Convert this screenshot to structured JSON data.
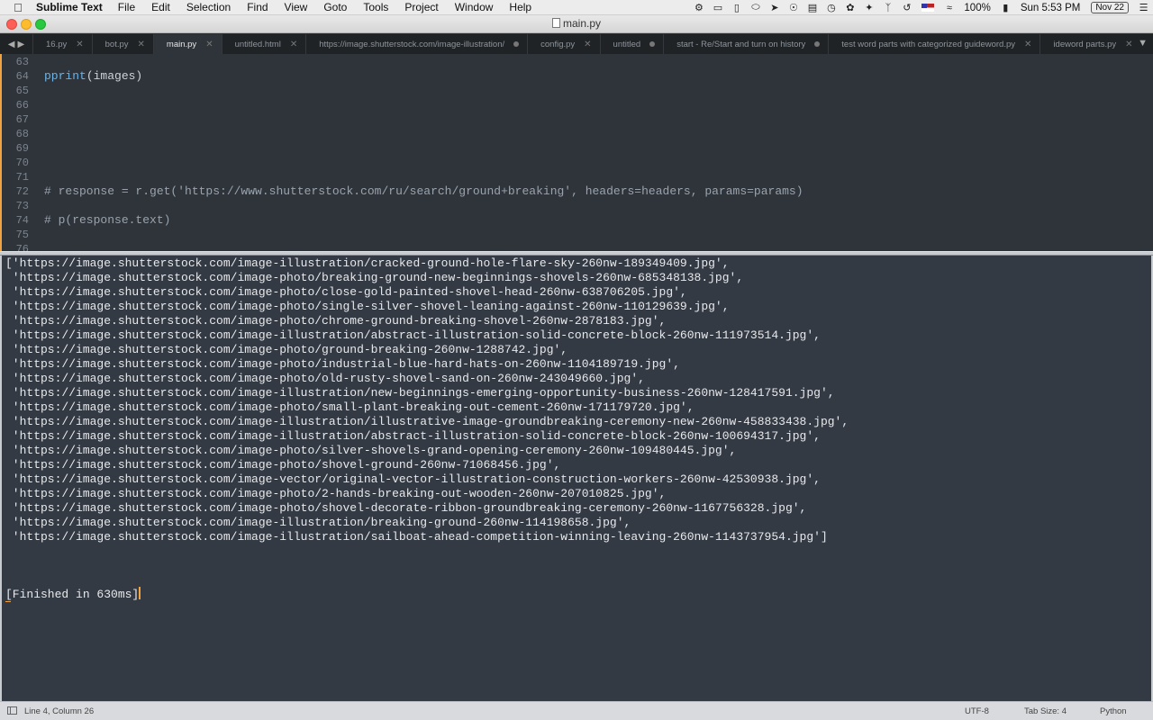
{
  "menubar": {
    "app_name": "Sublime Text",
    "items": [
      "File",
      "Edit",
      "Selection",
      "Find",
      "View",
      "Goto",
      "Tools",
      "Project",
      "Window",
      "Help"
    ],
    "battery": "100%",
    "clock": "Sun 5:53 PM",
    "date_badge": "Nov 22"
  },
  "window": {
    "title": "main.py"
  },
  "tabs": [
    {
      "label": "16.py",
      "state": "close"
    },
    {
      "label": "bot.py",
      "state": "close"
    },
    {
      "label": "main.py",
      "state": "close",
      "active": true
    },
    {
      "label": "untitled.html",
      "state": "close"
    },
    {
      "label": "https://image.shutterstock.com/image-illustration/",
      "state": "dirty"
    },
    {
      "label": "config.py",
      "state": "close"
    },
    {
      "label": "untitled",
      "state": "dirty"
    },
    {
      "label": "start - Re/Start and turn on history",
      "state": "dirty"
    },
    {
      "label": "test word parts with categorized guideword.py",
      "state": "close"
    },
    {
      "label": "ideword parts.py",
      "state": "close"
    }
  ],
  "editor": {
    "lines": [
      {
        "num": "63",
        "code": ""
      },
      {
        "num": "64",
        "code": "pprint(images)",
        "kind": "call"
      },
      {
        "num": "65",
        "code": ""
      },
      {
        "num": "66",
        "code": ""
      },
      {
        "num": "67",
        "code": ""
      },
      {
        "num": "68",
        "code": ""
      },
      {
        "num": "69",
        "code": ""
      },
      {
        "num": "70",
        "code": ""
      },
      {
        "num": "71",
        "code": ""
      },
      {
        "num": "72",
        "code": "# response = r.get('https://www.shutterstock.com/ru/search/ground+breaking', headers=headers, params=params)",
        "kind": "comment"
      },
      {
        "num": "73",
        "code": ""
      },
      {
        "num": "74",
        "code": "# p(response.text)",
        "kind": "comment"
      },
      {
        "num": "75",
        "code": ""
      },
      {
        "num": "76",
        "code": ""
      }
    ]
  },
  "output": {
    "lines": [
      "['https://image.shutterstock.com/image-illustration/cracked-ground-hole-flare-sky-260nw-189349409.jpg',",
      " 'https://image.shutterstock.com/image-photo/breaking-ground-new-beginnings-shovels-260nw-685348138.jpg',",
      " 'https://image.shutterstock.com/image-photo/close-gold-painted-shovel-head-260nw-638706205.jpg',",
      " 'https://image.shutterstock.com/image-photo/single-silver-shovel-leaning-against-260nw-110129639.jpg',",
      " 'https://image.shutterstock.com/image-photo/chrome-ground-breaking-shovel-260nw-2878183.jpg',",
      " 'https://image.shutterstock.com/image-illustration/abstract-illustration-solid-concrete-block-260nw-111973514.jpg',",
      " 'https://image.shutterstock.com/image-photo/ground-breaking-260nw-1288742.jpg',",
      " 'https://image.shutterstock.com/image-photo/industrial-blue-hard-hats-on-260nw-1104189719.jpg',",
      " 'https://image.shutterstock.com/image-photo/old-rusty-shovel-sand-on-260nw-243049660.jpg',",
      " 'https://image.shutterstock.com/image-illustration/new-beginnings-emerging-opportunity-business-260nw-128417591.jpg',",
      " 'https://image.shutterstock.com/image-photo/small-plant-breaking-out-cement-260nw-171179720.jpg',",
      " 'https://image.shutterstock.com/image-illustration/illustrative-image-groundbreaking-ceremony-new-260nw-458833438.jpg',",
      " 'https://image.shutterstock.com/image-illustration/abstract-illustration-solid-concrete-block-260nw-100694317.jpg',",
      " 'https://image.shutterstock.com/image-photo/silver-shovels-grand-opening-ceremony-260nw-109480445.jpg',",
      " 'https://image.shutterstock.com/image-photo/shovel-ground-260nw-71068456.jpg',",
      " 'https://image.shutterstock.com/image-vector/original-vector-illustration-construction-workers-260nw-42530938.jpg',",
      " 'https://image.shutterstock.com/image-photo/2-hands-breaking-out-wooden-260nw-207010825.jpg',",
      " 'https://image.shutterstock.com/image-photo/shovel-decorate-ribbon-groundbreaking-ceremony-260nw-1167756328.jpg',",
      " 'https://image.shutterstock.com/image-illustration/breaking-ground-260nw-114198658.jpg',",
      " 'https://image.shutterstock.com/image-illustration/sailboat-ahead-competition-winning-leaving-260nw-1143737954.jpg']"
    ],
    "finished": "[Finished in 630ms]"
  },
  "statusbar": {
    "position": "Line 4, Column 26",
    "encoding": "UTF-8",
    "tab_size": "Tab Size: 4",
    "syntax": "Python"
  },
  "colors": {
    "accent_orange": "#f2a341",
    "editor_bg": "#2f343b",
    "output_bg": "#343a43",
    "function_blue": "#68b3e8"
  }
}
